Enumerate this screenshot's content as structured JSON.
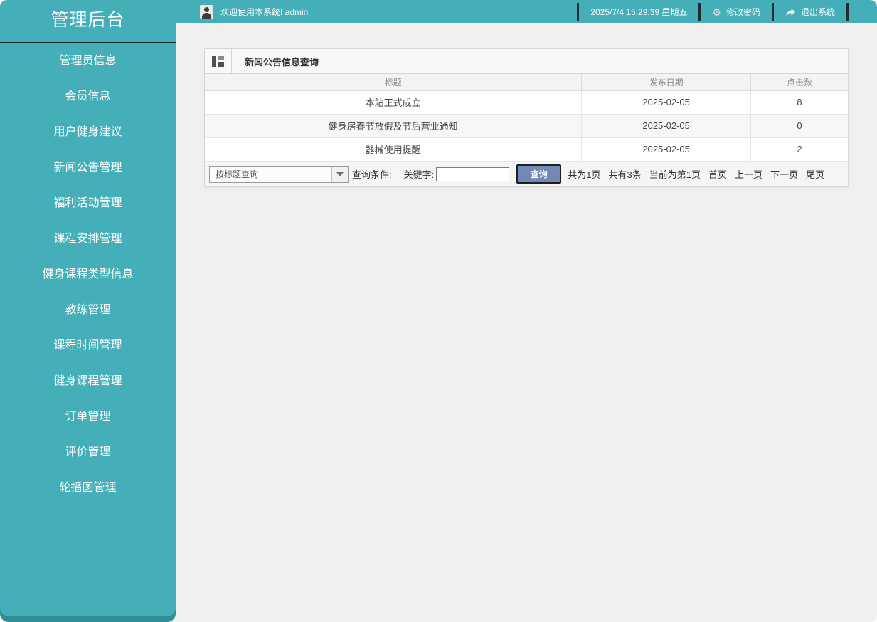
{
  "app": {
    "title": "管理后台"
  },
  "topbar": {
    "welcome": "欢迎使用本系统! admin",
    "datetime": "2025/7/4 15:29:39 星期五",
    "change_password": "修改密码",
    "logout": "退出系统",
    "gear_glyph": "⚙"
  },
  "sidebar": {
    "items": [
      "管理员信息",
      "会员信息",
      "用户健身建议",
      "新闻公告管理",
      "福利活动管理",
      "课程安排管理",
      "健身课程类型信息",
      "教练管理",
      "课程时间管理",
      "健身课程管理",
      "订单管理",
      "评价管理",
      "轮播图管理"
    ]
  },
  "panel": {
    "title": "新闻公告信息查询",
    "table": {
      "columns": [
        "标题",
        "发布日期",
        "点击数"
      ],
      "rows": [
        [
          "本站正式成立",
          "2025-02-05",
          "8"
        ],
        [
          "健身房春节放假及节后营业通知",
          "2025-02-05",
          "0"
        ],
        [
          "器械使用提醒",
          "2025-02-05",
          "2"
        ]
      ]
    },
    "search": {
      "dropdown_value": "按标题查询",
      "condition_label": "查询条件:",
      "keyword_label": "关键字:",
      "keyword_value": "",
      "button_label": "查询"
    },
    "pagination": {
      "total_pages": "共为1页",
      "total_items": "共有3条",
      "current_page": "当前为第1页",
      "first": "首页",
      "prev": "上一页",
      "next": "下一页",
      "last": "尾页"
    }
  },
  "icons": {
    "user": "person-silhouette-css",
    "gear": "⚙",
    "logout": "curved-right-arrow-svg",
    "panel": "grid-layout-css",
    "dropdown": "▼"
  },
  "colors": {
    "teal": "#45afb9",
    "teal_dark": "#2e8e97",
    "topbar_separator": "#1c2e31",
    "content_bg": "#f0efed",
    "button_blue": "#7289b8"
  }
}
